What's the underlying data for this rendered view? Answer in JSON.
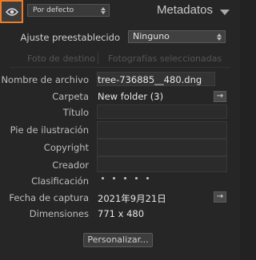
{
  "header": {
    "preset_selector": "Por defecto",
    "title": "Metadatos"
  },
  "preset_row": {
    "label": "Ajuste preestablecido",
    "value": "Ninguno"
  },
  "target_tabs": {
    "tab1": "Foto de destino",
    "tab2": "Fotografías seleccionadas"
  },
  "fields": {
    "filename": {
      "label": "Nombre de archivo",
      "value": "tree-736885__480.dng"
    },
    "folder": {
      "label": "Carpeta",
      "value": "New folder (3)",
      "action": "→"
    },
    "title": {
      "label": "Título",
      "value": ""
    },
    "caption": {
      "label": "Pie de ilustración",
      "value": ""
    },
    "copyright": {
      "label": "Copyright",
      "value": ""
    },
    "creator": {
      "label": "Creador",
      "value": ""
    },
    "rating": {
      "label": "Clasificación",
      "stars": 0,
      "max": 5
    },
    "capture_date": {
      "label": "Fecha de captura",
      "value": "2021年9月21日",
      "action": "→"
    },
    "dimensions": {
      "label": "Dimensiones",
      "value": "771 x 480"
    }
  },
  "customize_button": "Personalizar...",
  "colors": {
    "accent": "#f47c20",
    "panel": "#262626"
  }
}
